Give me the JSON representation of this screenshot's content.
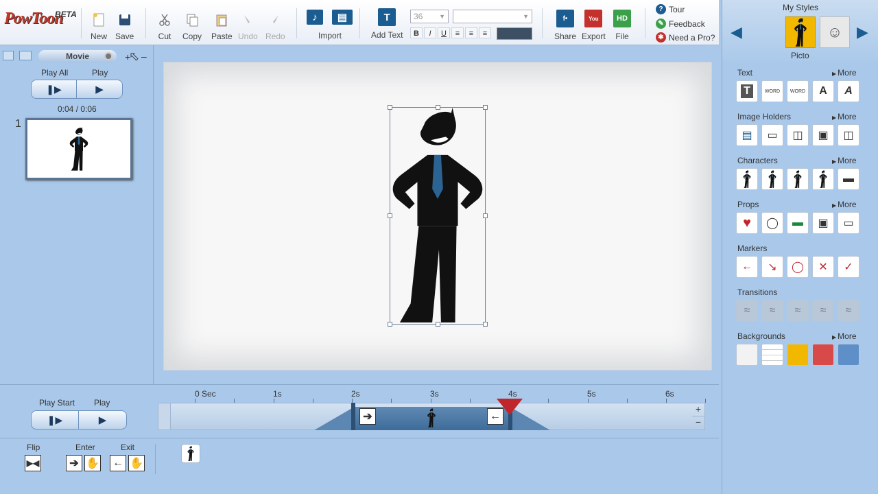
{
  "app": {
    "logo": "PowToon",
    "beta": "BETA"
  },
  "toolbar": {
    "new": "New",
    "save": "Save",
    "cut": "Cut",
    "copy": "Copy",
    "paste": "Paste",
    "undo": "Undo",
    "redo": "Redo",
    "import": "Import",
    "add_text": "Add Text",
    "font_size": "36",
    "bold": "B",
    "italic": "I",
    "underline": "U",
    "share": "Share",
    "export": "Export",
    "file": "File",
    "hd": "HD",
    "tour": "Tour",
    "feedback": "Feedback",
    "need_pro": "Need a Pro?"
  },
  "left": {
    "tab_label": "Movie",
    "play_all": "Play All",
    "play": "Play",
    "time": "0:04 / 0:06",
    "slide_number": "1"
  },
  "timeline": {
    "play_start": "Play Start",
    "play": "Play",
    "ticks": [
      "0 Sec",
      "1s",
      "2s",
      "3s",
      "4s",
      "5s",
      "6s"
    ],
    "flip": "Flip",
    "enter": "Enter",
    "exit": "Exit",
    "enter_time_s": 2,
    "exit_time_s": 4,
    "playhead_s": 4,
    "plus": "+",
    "minus": "−"
  },
  "right": {
    "my_styles": "My Styles",
    "style_name": "Picto",
    "more": "More",
    "categories": {
      "text": "Text",
      "image_holders": "Image Holders",
      "characters": "Characters",
      "props": "Props",
      "markers": "Markers",
      "transitions": "Transitions",
      "backgrounds": "Backgrounds"
    },
    "background_colors": [
      "#f2f2f2",
      "#ffffff",
      "#f2b800",
      "#d84a4a",
      "#5e8fc9"
    ]
  },
  "colors": {
    "panel": "#a9c8ea",
    "accent": "#1b5c91",
    "playhead": "#c0272d"
  }
}
